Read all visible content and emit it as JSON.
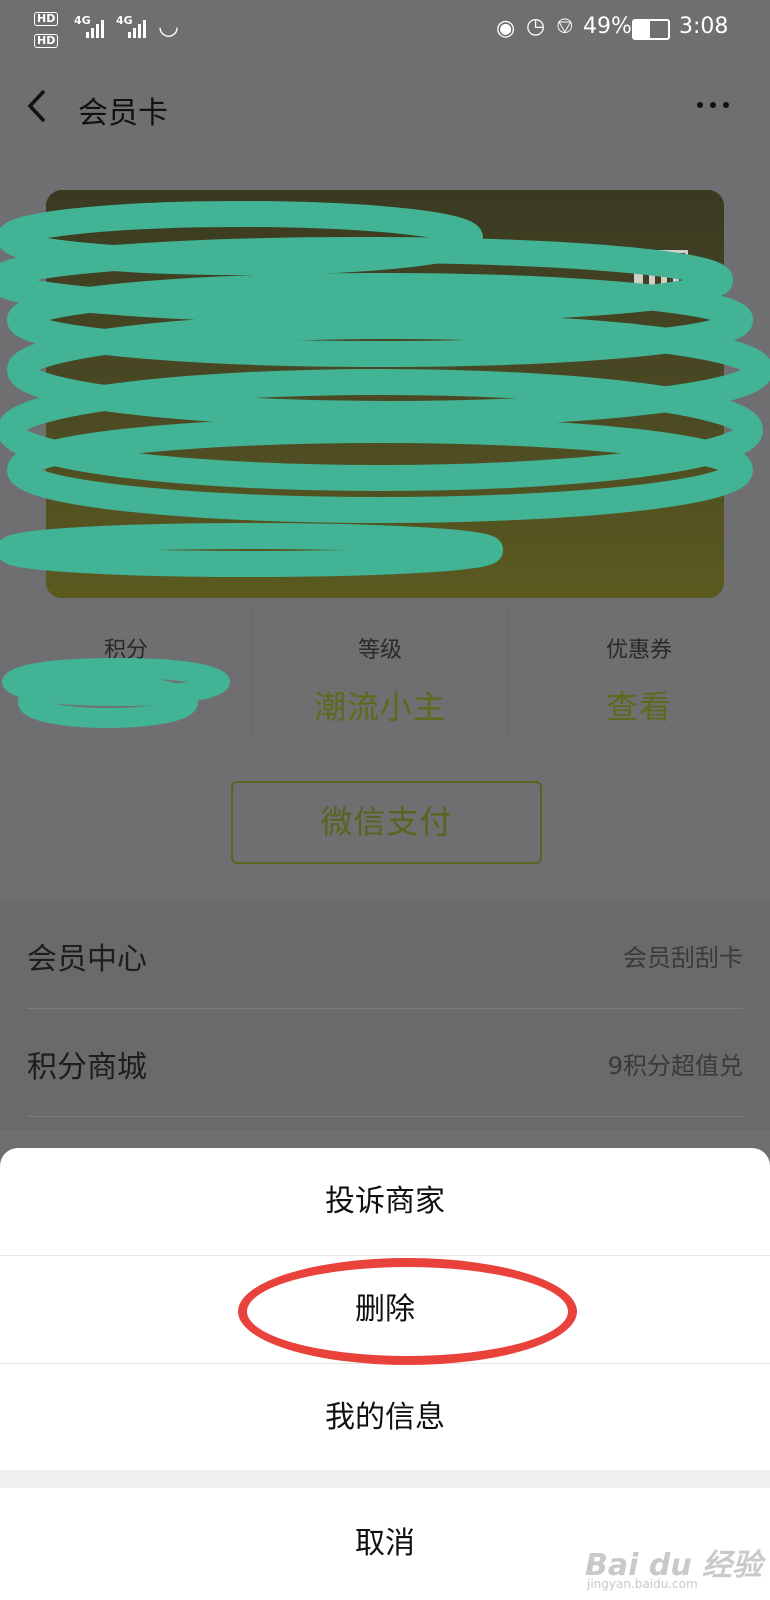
{
  "status": {
    "hd1": "HD",
    "hd2": "HD",
    "net1": "4G",
    "net2": "4G",
    "battery": "49%",
    "time": "3:08",
    "icons": [
      "eye-icon",
      "alarm-icon",
      "bell-off-icon",
      "battery-icon"
    ]
  },
  "header": {
    "title": "会员卡"
  },
  "card": {
    "qr": "qr-code-icon"
  },
  "stats": [
    {
      "label": "积分",
      "value": ""
    },
    {
      "label": "等级",
      "value": "潮流小主"
    },
    {
      "label": "优惠券",
      "value": "查看"
    }
  ],
  "pay_button": "微信支付",
  "rows": [
    {
      "title": "会员中心",
      "sub": "会员刮刮卡"
    },
    {
      "title": "积分商城",
      "sub": "9积分超值兑"
    }
  ],
  "sheet": {
    "items": [
      "投诉商家",
      "删除",
      "我的信息"
    ],
    "cancel": "取消"
  },
  "watermark": {
    "logo": "Bai du 经验",
    "url": "jingyan.baidu.com"
  },
  "colors": {
    "accent_green": "#5b6b1c",
    "annotation_red": "#e8423a",
    "scribble_teal": "#42b395"
  }
}
